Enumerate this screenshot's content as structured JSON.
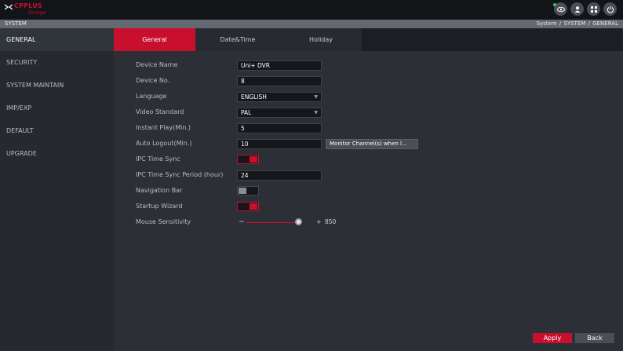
{
  "brand": {
    "logo_text": "CPPLUS",
    "logo_sub": "Orange",
    "logo_color": "#c8102e"
  },
  "topbar": {
    "icons": [
      "eye-icon",
      "user-icon",
      "grid-icon",
      "power-icon"
    ],
    "status_dot_color": "#2fd15a"
  },
  "titlebar": {
    "title": "SYSTEM",
    "breadcrumb": "System / SYSTEM / GENERAL"
  },
  "sidebar": {
    "items": [
      {
        "label": "GENERAL",
        "active": true
      },
      {
        "label": "SECURITY",
        "active": false
      },
      {
        "label": "SYSTEM MAINTAIN",
        "active": false
      },
      {
        "label": "IMP/EXP",
        "active": false
      },
      {
        "label": "DEFAULT",
        "active": false
      },
      {
        "label": "UPGRADE",
        "active": false
      }
    ]
  },
  "tabs": [
    {
      "label": "General",
      "active": true
    },
    {
      "label": "Date&Time",
      "active": false
    },
    {
      "label": "Holiday",
      "active": false
    }
  ],
  "form": {
    "device_name": {
      "label": "Device Name",
      "value": "Uni+ DVR"
    },
    "device_no": {
      "label": "Device No.",
      "value": "8"
    },
    "language": {
      "label": "Language",
      "value": "ENGLISH"
    },
    "video_standard": {
      "label": "Video Standard",
      "value": "PAL"
    },
    "instant_play": {
      "label": "Instant Play(Min.)",
      "value": "5"
    },
    "auto_logout": {
      "label": "Auto Logout(Min.)",
      "value": "10",
      "button": "Monitor Channel(s) when l..."
    },
    "ipc_time_sync": {
      "label": "IPC Time Sync",
      "enabled": true
    },
    "ipc_sync_period": {
      "label": "IPC Time Sync Period (hour)",
      "value": "24"
    },
    "navigation_bar": {
      "label": "Navigation Bar",
      "enabled": false
    },
    "startup_wizard": {
      "label": "Startup Wizard",
      "enabled": true
    },
    "mouse_sensitivity": {
      "label": "Mouse Sensitivity",
      "minus": "−",
      "plus": "+",
      "value": "850"
    }
  },
  "actions": {
    "apply": "Apply",
    "back": "Back"
  },
  "colors": {
    "accent": "#c8102e",
    "panel": "#2c2f35",
    "sidebar": "#26292f"
  }
}
